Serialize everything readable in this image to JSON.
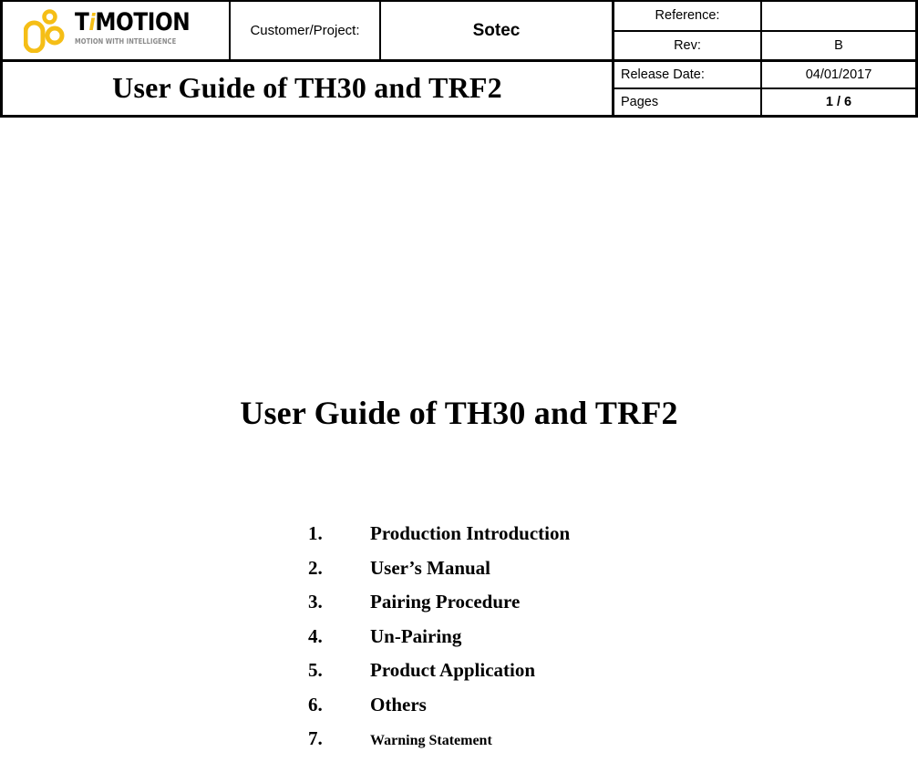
{
  "header": {
    "logo": {
      "wordmark_pre": "T",
      "wordmark_i": "i",
      "wordmark_post": "MOTION",
      "tagline": "MOTION WITH INTELLIGENCE",
      "brand_color": "#F5BE16",
      "tagline_color": "#8a8a8a"
    },
    "customer_label": "Customer/Project:",
    "customer_value": "Sotec",
    "document_title": "User Guide of TH30 and TRF2",
    "meta": [
      {
        "key": "Reference:",
        "value": "",
        "align": "center",
        "bold": false
      },
      {
        "key": "Rev:",
        "value": "B",
        "align": "center",
        "bold": false
      },
      {
        "key": "Release Date:",
        "value": "04/01/2017",
        "align": "left",
        "bold": false
      },
      {
        "key": "Pages",
        "value": "1 / 6",
        "align": "left",
        "bold": true
      }
    ]
  },
  "body": {
    "title": "User Guide of TH30 and TRF2",
    "contents": [
      {
        "num": "1.",
        "label": "Production Introduction",
        "small": false
      },
      {
        "num": "2.",
        "label": "User’s Manual",
        "small": false
      },
      {
        "num": "3.",
        "label": "Pairing Procedure",
        "small": false
      },
      {
        "num": "4.",
        "label": "Un-Pairing",
        "small": false
      },
      {
        "num": "5.",
        "label": "Product Application",
        "small": false
      },
      {
        "num": "6.",
        "label": "Others",
        "small": false
      },
      {
        "num": "7.",
        "label": "Warning Statement",
        "small": true
      }
    ]
  }
}
